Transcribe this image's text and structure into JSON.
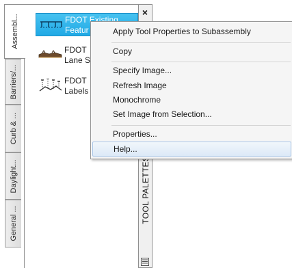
{
  "left_tabs": [
    {
      "label": "Assembl..."
    },
    {
      "label": "Barriers/..."
    },
    {
      "label": "Curb & ..."
    },
    {
      "label": "Daylight..."
    },
    {
      "label": "General ..."
    }
  ],
  "palette": {
    "items": [
      {
        "line1": "FDOT Existing",
        "line2": "Featur",
        "icon": "existing-features-icon"
      },
      {
        "line1": "FDOT",
        "line2": "Lane S",
        "icon": "lane-subassembly-icon"
      },
      {
        "line1": "FDOT",
        "line2": "Labels",
        "icon": "labels-icon"
      }
    ]
  },
  "titlebar": {
    "close_label": "×",
    "title": "TOOL PALETTES - FDOT"
  },
  "context_menu": {
    "items": [
      {
        "label": "Apply Tool Properties to Subassembly"
      },
      {
        "label": "Copy"
      },
      {
        "label": "Specify Image..."
      },
      {
        "label": "Refresh Image"
      },
      {
        "label": "Monochrome"
      },
      {
        "label": "Set Image from Selection..."
      },
      {
        "label": "Properties..."
      },
      {
        "label": "Help..."
      }
    ],
    "highlighted": "Help..."
  },
  "colors": {
    "selection": "#20a9e5",
    "menu_bg": "#f5f5f5",
    "menu_hover": "#dce9f7"
  }
}
